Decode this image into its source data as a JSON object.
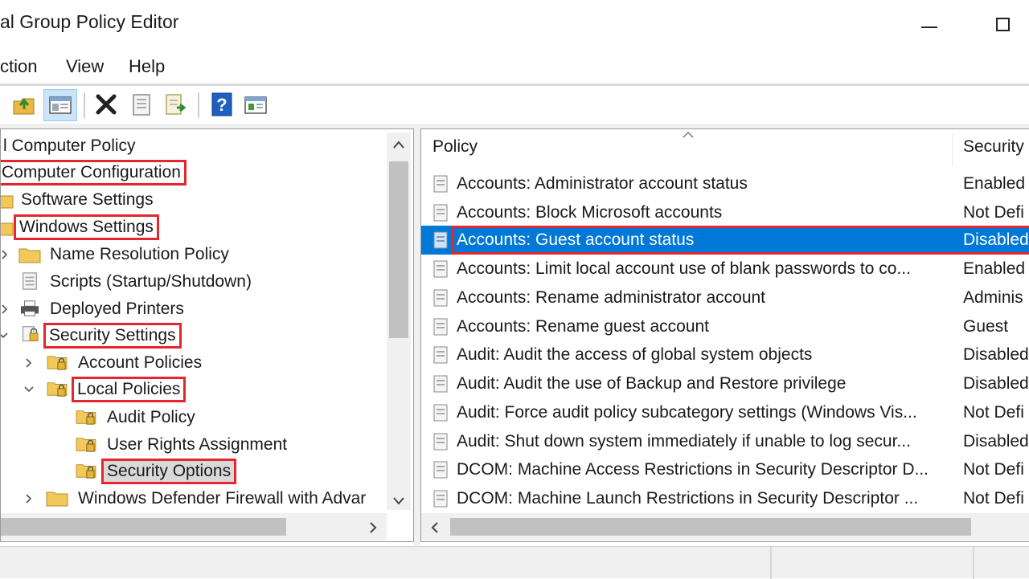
{
  "window": {
    "title": "al Group Policy Editor",
    "controls": {
      "minimize_icon": "minimize-icon",
      "maximize_icon": "maximize-icon"
    }
  },
  "menu": [
    {
      "label": "ction"
    },
    {
      "label": "View"
    },
    {
      "label": "Help"
    }
  ],
  "toolbar": {
    "icons": [
      "up-folder-icon",
      "show-hide-tree-icon",
      "delete-icon",
      "properties-icon",
      "export-list-icon",
      "help-icon",
      "console-view-icon"
    ]
  },
  "tree": {
    "items": [
      {
        "label": "l Computer Policy"
      },
      {
        "label": "Computer Configuration"
      },
      {
        "label": "Software Settings"
      },
      {
        "label": "Windows Settings"
      },
      {
        "label": "Name Resolution Policy"
      },
      {
        "label": "Scripts (Startup/Shutdown)"
      },
      {
        "label": "Deployed Printers"
      },
      {
        "label": "Security Settings"
      },
      {
        "label": "Account Policies"
      },
      {
        "label": "Local Policies"
      },
      {
        "label": "Audit Policy"
      },
      {
        "label": "User Rights Assignment"
      },
      {
        "label": "Security Options"
      },
      {
        "label": "Windows Defender Firewall with Advar"
      }
    ]
  },
  "list": {
    "columns": [
      {
        "label": "Policy"
      },
      {
        "label": "Security"
      }
    ],
    "rows": [
      {
        "policy": "Accounts: Administrator account status",
        "setting": "Enabled"
      },
      {
        "policy": "Accounts: Block Microsoft accounts",
        "setting": "Not Defi"
      },
      {
        "policy": "Accounts: Guest account status",
        "setting": "Disabled"
      },
      {
        "policy": "Accounts: Limit local account use of blank passwords to co...",
        "setting": "Enabled"
      },
      {
        "policy": "Accounts: Rename administrator account",
        "setting": "Adminis"
      },
      {
        "policy": "Accounts: Rename guest account",
        "setting": "Guest"
      },
      {
        "policy": "Audit: Audit the access of global system objects",
        "setting": "Disabled"
      },
      {
        "policy": "Audit: Audit the use of Backup and Restore privilege",
        "setting": "Disabled"
      },
      {
        "policy": "Audit: Force audit policy subcategory settings (Windows Vis...",
        "setting": "Not Defi"
      },
      {
        "policy": "Audit: Shut down system immediately if unable to log secur...",
        "setting": "Disabled"
      },
      {
        "policy": "DCOM: Machine Access Restrictions in Security Descriptor D...",
        "setting": "Not Defi"
      },
      {
        "policy": "DCOM: Machine Launch Restrictions in Security Descriptor ...",
        "setting": "Not Defi"
      }
    ],
    "selected_row": "Accounts: Guest account status"
  },
  "colors": {
    "highlight_outline": "#e5262e",
    "selection": "#0078d7",
    "folder": "#f3c85a"
  }
}
